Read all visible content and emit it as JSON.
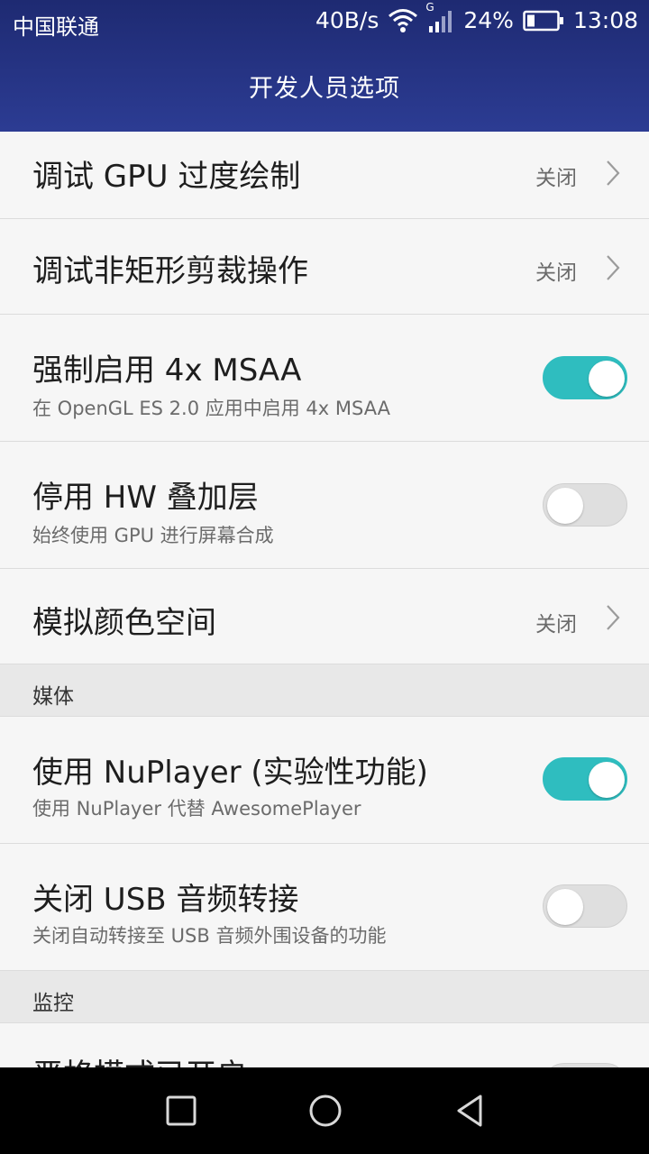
{
  "status": {
    "carrier": "中国联通",
    "speed": "40B/s",
    "network_type": "G",
    "battery": "24%",
    "time": "13:08"
  },
  "appbar": {
    "title": "开发人员选项"
  },
  "rows": [
    {
      "title": "调试 GPU 过度绘制",
      "value": "关闭"
    },
    {
      "title": "调试非矩形剪裁操作",
      "value": "关闭"
    },
    {
      "title": "强制启用 4x MSAA",
      "subtitle": "在 OpenGL ES 2.0 应用中启用 4x MSAA",
      "toggle_on": true
    },
    {
      "title": "停用 HW 叠加层",
      "subtitle": "始终使用 GPU 进行屏幕合成",
      "toggle_on": false
    },
    {
      "title": "模拟颜色空间",
      "value": "关闭"
    }
  ],
  "section_media": "媒体",
  "media_rows": [
    {
      "title": "使用 NuPlayer (实验性功能)",
      "subtitle": "使用 NuPlayer 代替 AwesomePlayer",
      "toggle_on": true
    },
    {
      "title": "关闭 USB 音频转接",
      "subtitle": "关闭自动转接至 USB 音频外围设备的功能",
      "toggle_on": false
    }
  ],
  "section_monitor": "监控",
  "monitor_rows": [
    {
      "title": "严格模式已开启"
    }
  ],
  "colors": {
    "header": "#24318a",
    "toggle_on": "#2fbdbf",
    "toggle_off": "#dfdfdf"
  },
  "icons": {
    "wifi": "wifi-icon",
    "signal": "signal-icon",
    "battery": "battery-icon",
    "chevron": "chevron-right-icon",
    "back": "back-triangle-icon",
    "home": "home-circle-icon",
    "recents": "recents-square-icon"
  }
}
